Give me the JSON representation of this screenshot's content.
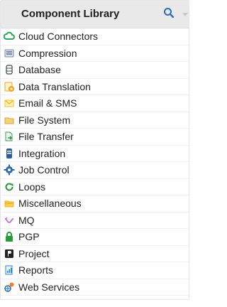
{
  "panel": {
    "title": "Component Library",
    "search": {
      "icon": "search-icon",
      "color": "#2c6fb1"
    },
    "menu_icon": "dropdown-caret-icon"
  },
  "items": [
    {
      "label": "Cloud Connectors",
      "icon": "cloud-icon",
      "color": "#2aa55a"
    },
    {
      "label": "Compression",
      "icon": "compression-icon",
      "color": "#7a8aa6"
    },
    {
      "label": "Database",
      "icon": "database-icon",
      "color": "#5b6677"
    },
    {
      "label": "Data Translation",
      "icon": "data-translation-icon",
      "color": "#f2a31b"
    },
    {
      "label": "Email & SMS",
      "icon": "email-icon",
      "color": "#f3c02e"
    },
    {
      "label": "File System",
      "icon": "folder-icon",
      "color": "#e8c15b"
    },
    {
      "label": "File Transfer",
      "icon": "file-transfer-icon",
      "color": "#3d9a59"
    },
    {
      "label": "Integration",
      "icon": "integration-icon",
      "color": "#2f5d9a"
    },
    {
      "label": "Job Control",
      "icon": "gear-icon",
      "color": "#2f6aa8"
    },
    {
      "label": "Loops",
      "icon": "loop-icon",
      "color": "#2a9a3a"
    },
    {
      "label": "Miscellaneous",
      "icon": "misc-folder-icon",
      "color": "#f1b92a"
    },
    {
      "label": "MQ",
      "icon": "mq-icon",
      "color": "#c27bd2"
    },
    {
      "label": "PGP",
      "icon": "lock-icon",
      "color": "#2a9a3a"
    },
    {
      "label": "Project",
      "icon": "project-icon",
      "color": "#222222"
    },
    {
      "label": "Reports",
      "icon": "reports-icon",
      "color": "#2f86d8"
    },
    {
      "label": "Web Services",
      "icon": "web-services-icon",
      "color": "#2f6aa8"
    }
  ]
}
